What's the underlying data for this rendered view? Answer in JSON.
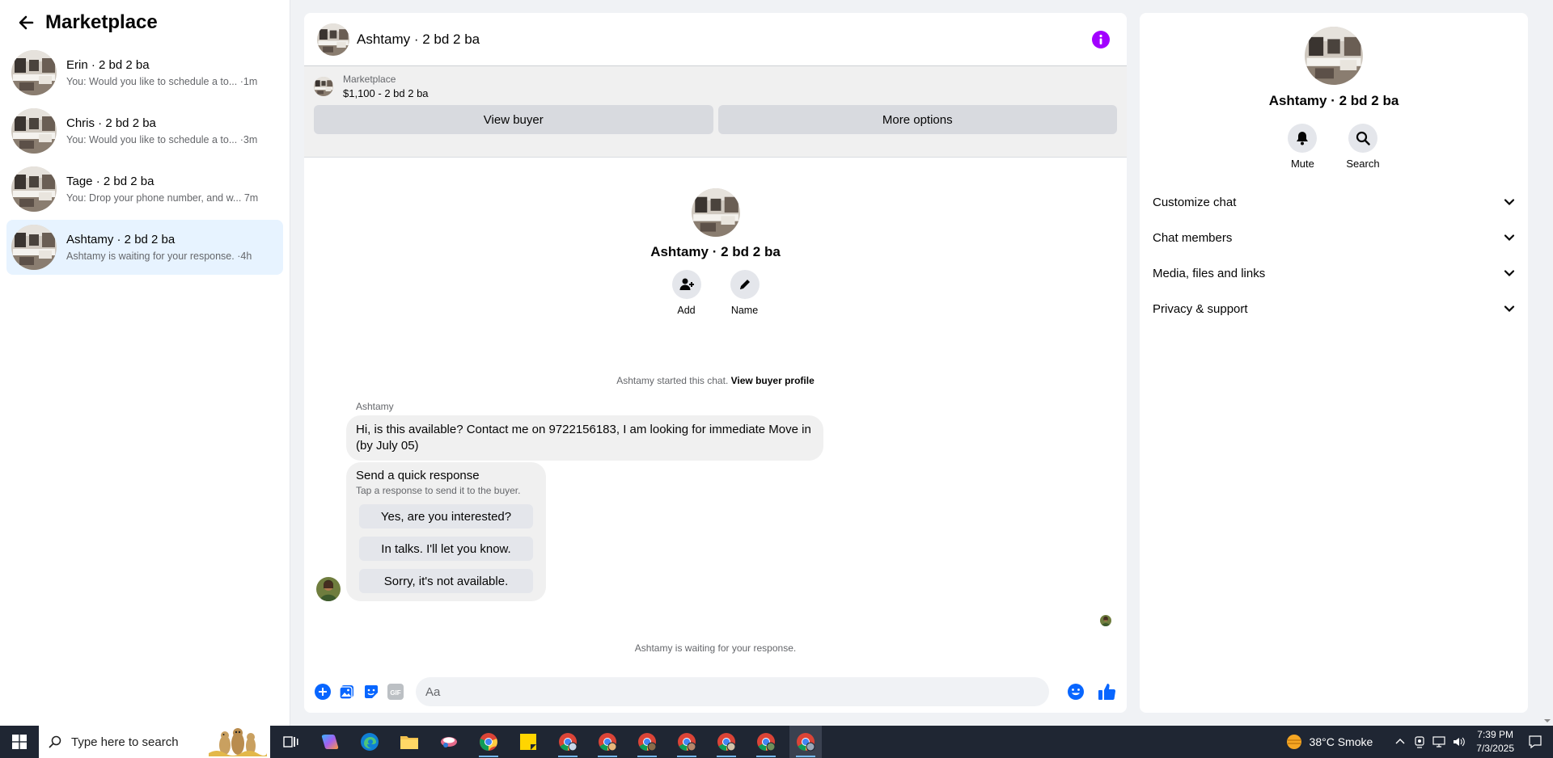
{
  "sidebar": {
    "title": "Marketplace",
    "conversations": [
      {
        "name": "Erin · 2 bd 2 ba",
        "preview": "You: Would you like to schedule a to... ·1m",
        "active": false
      },
      {
        "name": "Chris · 2 bd 2 ba",
        "preview": "You: Would you like to schedule a to... ·3m",
        "active": false
      },
      {
        "name": "Tage · 2 bd 2 ba",
        "preview": "You: Drop your phone number, and w... 7m",
        "active": false
      },
      {
        "name": "Ashtamy · 2 bd 2 ba",
        "preview": "Ashtamy is waiting for your response. ·4h",
        "active": true
      }
    ]
  },
  "chat": {
    "title": "Ashtamy · 2 bd 2 ba",
    "listing": {
      "label": "Marketplace",
      "price_line": "$1,100 - 2 bd 2 ba",
      "view_buyer": "View buyer",
      "more_options": "More options"
    },
    "intro": {
      "name": "Ashtamy · 2 bd 2 ba",
      "add_label": "Add",
      "name_label": "Name"
    },
    "started_text": "Ashtamy started this chat.",
    "started_link": "View buyer profile",
    "sender_name": "Ashtamy",
    "message": "Hi, is this available? Contact me on 9722156183, I am looking for immediate Move in (by July 05)",
    "quick_response": {
      "title": "Send a quick response",
      "subtitle": "Tap a response to send it to the buyer.",
      "options": [
        "Yes, are you interested?",
        "In talks. I'll let you know.",
        "Sorry, it's not available."
      ]
    },
    "waiting_text": "Ashtamy is waiting for your response.",
    "composer_placeholder": "Aa"
  },
  "right_panel": {
    "name": "Ashtamy · 2 bd 2 ba",
    "mute_label": "Mute",
    "search_label": "Search",
    "sections": [
      "Customize chat",
      "Chat members",
      "Media, files and links",
      "Privacy & support"
    ]
  },
  "taskbar": {
    "search_placeholder": "Type here to search",
    "weather": "38°C  Smoke",
    "time": "7:39 PM",
    "date": "7/3/2025"
  },
  "colors": {
    "accent_blue": "#0866ff",
    "info_purple": "#a200ff",
    "active_conv_bg": "#e7f3ff"
  }
}
